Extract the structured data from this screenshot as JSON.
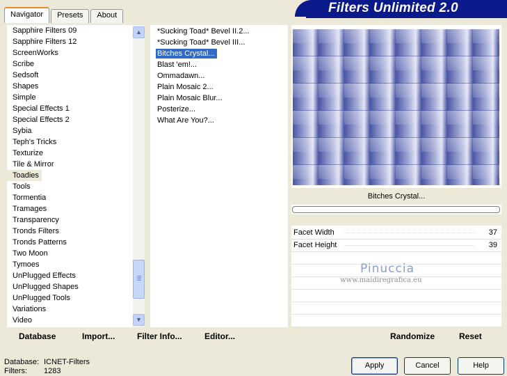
{
  "tabs": [
    "Navigator",
    "Presets",
    "About"
  ],
  "banner": "Filters Unlimited 2.0",
  "categories": [
    "Sapphire Filters 09",
    "Sapphire Filters 12",
    "ScreenWorks",
    "Scribe",
    "Sedsoft",
    "Shapes",
    "Simple",
    "Special Effects 1",
    "Special Effects 2",
    "Sybia",
    "Teph's Tricks",
    "Texturize",
    "Tile & Mirror",
    "Toadies",
    "Tools",
    "Tormentia",
    "Tramages",
    "Transparency",
    "Tronds Filters",
    "Tronds Patterns",
    "Two Moon",
    "Tymoes",
    "UnPlugged Effects",
    "UnPlugged Shapes",
    "UnPlugged Tools",
    "Variations",
    "Video"
  ],
  "filters": [
    "*Sucking Toad*  Bevel II.2...",
    "*Sucking Toad*  Bevel III...",
    "Bitches Crystal...",
    "Blast 'em!...",
    "Ommadawn...",
    "Plain Mosaic 2...",
    "Plain Mosaic Blur...",
    "Posterize...",
    "What Are You?..."
  ],
  "filter_name": "Bitches Crystal...",
  "params": [
    {
      "label": "Facet Width",
      "value": "37"
    },
    {
      "label": "Facet Height",
      "value": "39"
    }
  ],
  "watermark": {
    "title": "Pinuccia",
    "url": "www.maidiregrafica.eu"
  },
  "bottom_left": {
    "database": "Database",
    "import": "Import...",
    "filter_info": "Filter Info...",
    "editor": "Editor..."
  },
  "bottom_right": {
    "randomize": "Randomize",
    "reset": "Reset"
  },
  "status": {
    "database_label": "Database:",
    "database_value": "ICNET-Filters",
    "filters_label": "Filters:",
    "filters_value": "1283"
  },
  "buttons": {
    "apply": "Apply",
    "cancel": "Cancel",
    "help": "Help"
  },
  "colors": {
    "preview_dark": "#4a55a4",
    "preview_light": "#d8dbef",
    "selection": "#316ac5",
    "banner": "#0b1a8a"
  }
}
